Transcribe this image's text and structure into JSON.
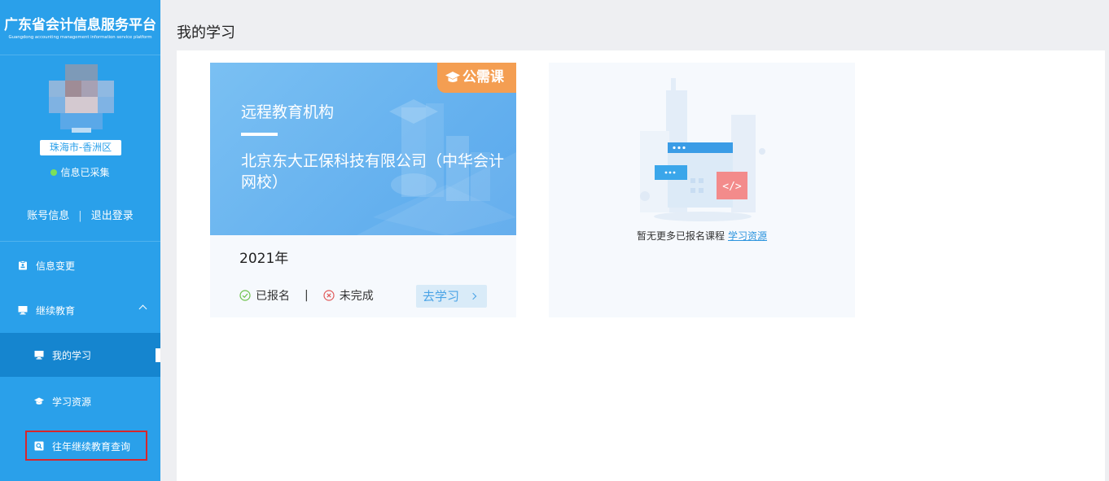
{
  "sidebar": {
    "logo_title": "广东省会计信息服务平台",
    "logo_subtitle": "Guangdong accounting management information service platform",
    "region": "珠海市-香洲区",
    "collect_status": "信息已采集",
    "account_info": "账号信息",
    "account_sep": "|",
    "logout": "退出登录",
    "menu": {
      "info_change": "信息变更",
      "continuing_edu": "继续教育",
      "my_study": "我的学习",
      "study_resources": "学习资源",
      "past_query": "往年继续教育查询"
    }
  },
  "main": {
    "page_title": "我的学习",
    "course": {
      "tag": "公需课",
      "org_label": "远程教育机构",
      "org_name": "北京东大正保科技有限公司（中华会计网校）",
      "year": "2021年",
      "registered": "已报名",
      "divider": "|",
      "incomplete": "未完成",
      "go_button": "去学习"
    },
    "empty": {
      "text": "暂无更多已报名课程",
      "link": "学习资源"
    }
  },
  "colors": {
    "sidebar_bg": "#2aa0ea",
    "sidebar_active": "#1585cf",
    "tag": "#f49e52",
    "link": "#2d95de",
    "highlight": "#d8262c"
  },
  "icons": {
    "info_change": "clipboard-icon",
    "continuing_edu": "monitor-icon",
    "my_study": "monitor-icon",
    "study_resources": "graduation-cap-icon",
    "past_query": "search-doc-icon",
    "registered": "check-circle-icon",
    "incomplete": "x-circle-icon"
  }
}
